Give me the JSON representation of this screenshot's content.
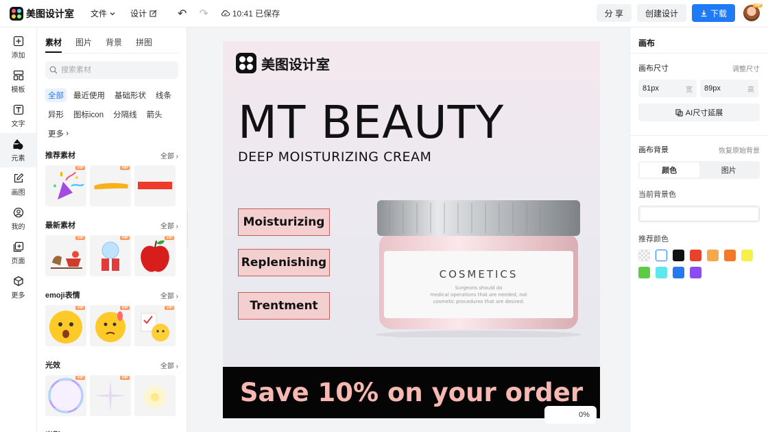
{
  "app": {
    "name": "美图设计室"
  },
  "topbar": {
    "file_label": "文件",
    "design_label": "设计",
    "saved_status": "10:41 已保存",
    "share_label": "分 享",
    "create_label": "创建设计",
    "download_label": "下载",
    "avatar_badge": "VIP"
  },
  "leftnav": {
    "items": [
      {
        "label": "添加",
        "icon": "plus-square-icon"
      },
      {
        "label": "模板",
        "icon": "template-grid-icon"
      },
      {
        "label": "文字",
        "icon": "text-t-icon"
      },
      {
        "label": "元素",
        "icon": "shapes-icon"
      },
      {
        "label": "画图",
        "icon": "pencil-edit-icon"
      },
      {
        "label": "我的",
        "icon": "user-icon"
      },
      {
        "label": "页面",
        "icon": "page-add-icon"
      },
      {
        "label": "更多",
        "icon": "cube-icon"
      }
    ],
    "active_index": 3
  },
  "panel": {
    "tabs": [
      "素材",
      "图片",
      "背景",
      "拼图"
    ],
    "search_placeholder": "搜索素材",
    "chips": [
      "全部",
      "最近使用",
      "基础形状",
      "线条",
      "异形",
      "图标icon",
      "分隔线",
      "箭头",
      "更多"
    ],
    "vip_label": "VIP",
    "all_label": "全部",
    "sections": [
      {
        "title": "推荐素材"
      },
      {
        "title": "最新素材"
      },
      {
        "title": "emoji表情"
      },
      {
        "title": "光效"
      },
      {
        "title": "光影"
      }
    ]
  },
  "canvas": {
    "logo_text": "美图设计室",
    "headline": "MT BEAUTY",
    "subheadline": "DEEP MOISTURIZING CREAM",
    "features": [
      "Moisturizing",
      "Replenishing",
      "Trentment"
    ],
    "jar_label": "COSMETICS",
    "jar_small_text": [
      "Surgeons should do",
      "medical operations that are needed, not",
      "cosmetic procedures that are desired."
    ],
    "banner": "Save 10% on your order",
    "zoom": "0%"
  },
  "rpanel": {
    "title": "画布",
    "size_label": "画布尺寸",
    "adjust_label": "调整尺寸",
    "width_value": "81px",
    "width_unit": "宽",
    "height_value": "89px",
    "height_unit": "高",
    "ai_label": "AI尺寸延展",
    "bg_label": "画布背景",
    "restore_label": "恢复原始背景",
    "seg_color": "颜色",
    "seg_image": "图片",
    "current_bg_label": "当前背景色",
    "recommended_label": "推荐颜色",
    "swatches": [
      "transparent",
      "#ffffff",
      "#111111",
      "#e8412c",
      "#f5a94a",
      "#f07a2a",
      "#f7f04a",
      "#5ecb45",
      "#5ee8ee",
      "#2878f0",
      "#8a4df0"
    ]
  },
  "colors": {
    "accent": "#1f7af5",
    "banner_text": "#f6b8b0",
    "feature_box": "#f3cfcf"
  }
}
